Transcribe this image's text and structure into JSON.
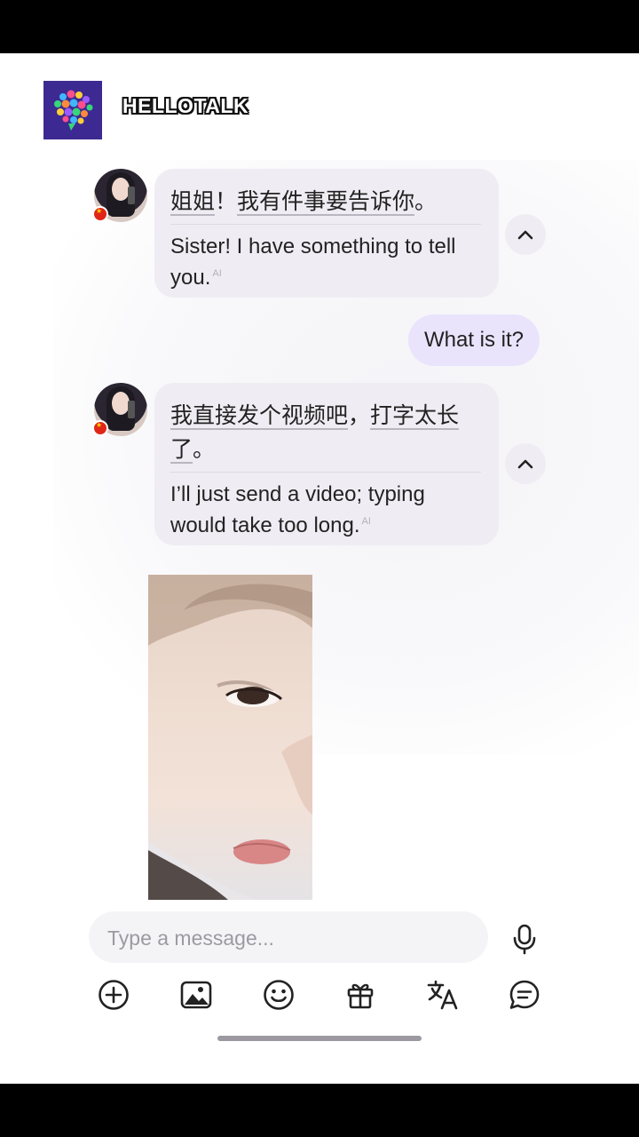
{
  "app": {
    "name": "HELLOTALK"
  },
  "messages": [
    {
      "direction": "received",
      "original": [
        "姐姐",
        "！",
        "我有件事要告诉你",
        "。"
      ],
      "translation": "Sister! I have something to tell you.",
      "ai_badge": "AI"
    },
    {
      "direction": "sent",
      "text": "What is it?"
    },
    {
      "direction": "received",
      "original_line1": [
        "我直接发个视频吧",
        "，",
        "打字太长"
      ],
      "original_line2": [
        "了",
        "。"
      ],
      "translation": "I’ll just send a video; typing would take too long.",
      "ai_badge": "AI"
    },
    {
      "direction": "received",
      "type": "video"
    }
  ],
  "composer": {
    "placeholder": "Type a message...",
    "value": ""
  },
  "toolbar": [
    "plus-icon",
    "image-icon",
    "emoji-icon",
    "gift-icon",
    "translate-icon",
    "comment-icon"
  ],
  "colors": {
    "received_bubble": "#efedf3",
    "sent_bubble": "#e9e4fc",
    "logo_bg": "#3c2a92"
  }
}
